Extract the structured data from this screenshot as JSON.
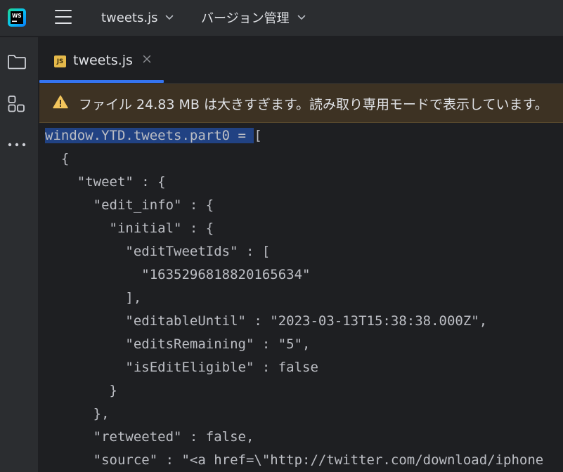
{
  "titlebar": {
    "project_menu": "tweets.js",
    "vcs_menu": "バージョン管理"
  },
  "tab": {
    "label": "tweets.js",
    "icon_text": "JS"
  },
  "banner": {
    "message": "ファイル 24.83 MB は大きすぎます。読み取り専用モードで表示しています。"
  },
  "editor": {
    "selected_text": "window.YTD.tweets.part0 = ",
    "lines": [
      "[",
      "  {",
      "    \"tweet\" : {",
      "      \"edit_info\" : {",
      "        \"initial\" : {",
      "          \"editTweetIds\" : [",
      "            \"1635296818820165634\"",
      "          ],",
      "          \"editableUntil\" : \"2023-03-13T15:38:38.000Z\",",
      "          \"editsRemaining\" : \"5\",",
      "          \"isEditEligible\" : false",
      "        }",
      "      },",
      "      \"retweeted\" : false,",
      "      \"source\" : \"<a href=\\\"http://twitter.com/download/iphone"
    ]
  },
  "colors": {
    "background": "#1e1f22",
    "panel": "#2b2d30",
    "accent": "#3574f0",
    "warning_banner": "#3d3223",
    "warning_icon": "#f2c55c",
    "selection": "#214283"
  }
}
